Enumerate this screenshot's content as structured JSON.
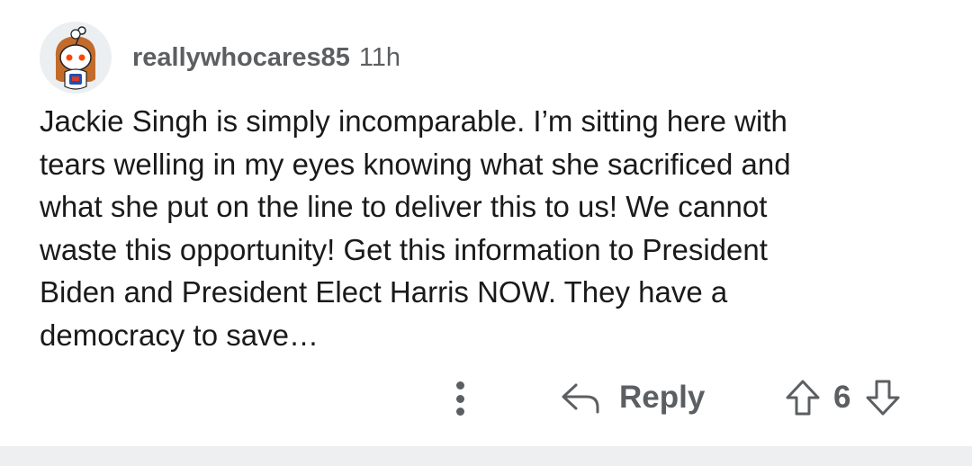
{
  "comment": {
    "username": "reallywhocares85",
    "timestamp": "11h",
    "avatar_icon": "snoo-avatar-icon",
    "text_lines": [
      "Jackie Singh is simply incomparable. I’m sitting here with",
      "tears welling in my eyes knowing what she sacrificed and",
      "what she put on the line to deliver this to us! We cannot",
      "waste this opportunity! Get this information to President",
      "Biden and President Elect Harris NOW. They have a",
      "democracy to save…"
    ]
  },
  "actions": {
    "more_icon": "more-vertical-icon",
    "reply_icon": "reply-arrow-icon",
    "reply_label": "Reply",
    "upvote_icon": "upvote-arrow-icon",
    "vote_count": "6",
    "downvote_icon": "downvote-arrow-icon"
  },
  "colors": {
    "text_primary": "#1a1a1b",
    "text_secondary": "#5c5f62",
    "divider_bar": "#eeeff1",
    "avatar_bg": "#eceff1"
  }
}
